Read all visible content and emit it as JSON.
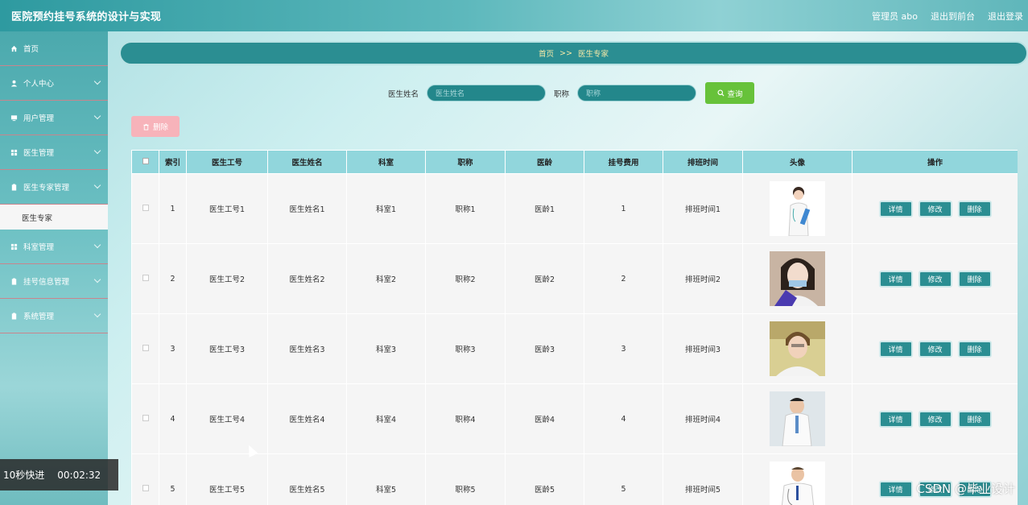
{
  "header": {
    "title": "医院预约挂号系统的设计与实现",
    "user_label": "管理员 abo",
    "back_to_front": "退出到前台",
    "logout": "退出登录"
  },
  "sidebar": {
    "items": [
      {
        "label": "首页",
        "icon": "home-icon"
      },
      {
        "label": "个人中心",
        "icon": "user-icon"
      },
      {
        "label": "用户管理",
        "icon": "monitor-icon"
      },
      {
        "label": "医生管理",
        "icon": "grid-icon"
      },
      {
        "label": "医生专家管理",
        "icon": "clipboard-icon"
      },
      {
        "label": "科室管理",
        "icon": "grid-icon"
      },
      {
        "label": "挂号信息管理",
        "icon": "clipboard-icon"
      },
      {
        "label": "系统管理",
        "icon": "clipboard-icon"
      }
    ],
    "active_sub": "医生专家"
  },
  "breadcrumb": {
    "home": "首页",
    "sep": ">>",
    "current": "医生专家"
  },
  "search": {
    "name_label": "医生姓名",
    "name_placeholder": "医生姓名",
    "title_label": "职称",
    "title_placeholder": "职称",
    "query_button": "查询"
  },
  "batch_delete": "删除",
  "table": {
    "headers": [
      "",
      "索引",
      "医生工号",
      "医生姓名",
      "科室",
      "职称",
      "医龄",
      "挂号费用",
      "排班时间",
      "头像",
      "操作"
    ],
    "rows": [
      {
        "index": "1",
        "id": "医生工号1",
        "name": "医生姓名1",
        "dept": "科室1",
        "title": "职称1",
        "age": "医龄1",
        "fee": "1",
        "schedule": "排班时间1"
      },
      {
        "index": "2",
        "id": "医生工号2",
        "name": "医生姓名2",
        "dept": "科室2",
        "title": "职称2",
        "age": "医龄2",
        "fee": "2",
        "schedule": "排班时间2"
      },
      {
        "index": "3",
        "id": "医生工号3",
        "name": "医生姓名3",
        "dept": "科室3",
        "title": "职称3",
        "age": "医龄3",
        "fee": "3",
        "schedule": "排班时间3"
      },
      {
        "index": "4",
        "id": "医生工号4",
        "name": "医生姓名4",
        "dept": "科室4",
        "title": "职称4",
        "age": "医龄4",
        "fee": "4",
        "schedule": "排班时间4"
      },
      {
        "index": "5",
        "id": "医生工号5",
        "name": "医生姓名5",
        "dept": "科室5",
        "title": "职称5",
        "age": "医龄5",
        "fee": "5",
        "schedule": "排班时间5"
      }
    ],
    "actions": {
      "detail": "详情",
      "edit": "修改",
      "delete": "删除"
    }
  },
  "overlay": {
    "fast_forward": "10秒快进",
    "time": "00:02:32",
    "watermark": "CSDN @毕业设计"
  }
}
